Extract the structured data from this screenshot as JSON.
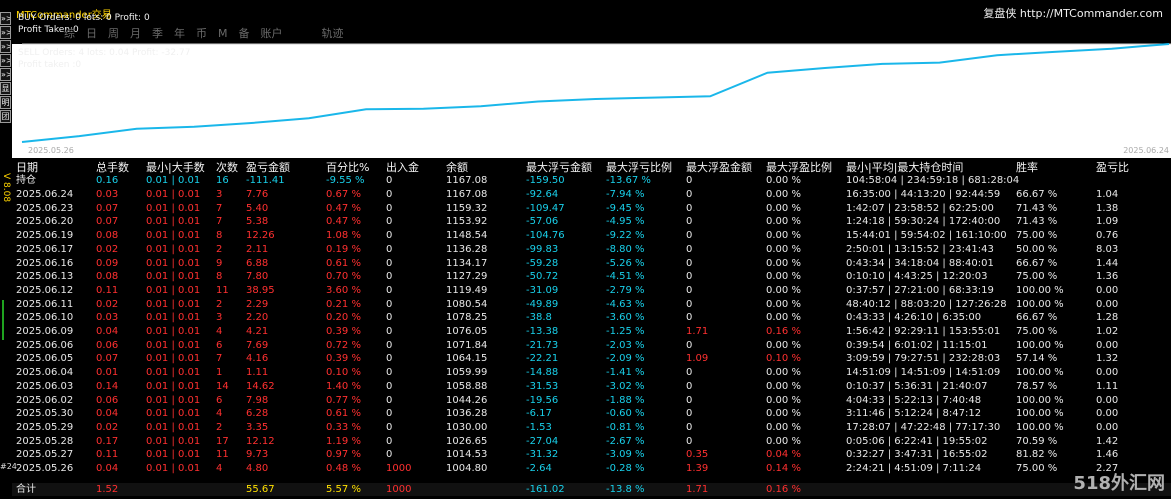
{
  "left_strip": {
    "buttons": [
      "»>",
      "»>",
      "»>",
      "»>",
      "»>",
      "显",
      "明",
      "团"
    ],
    "vertical_label": "V 8.08",
    "bottom_label": "#24"
  },
  "chart": {
    "app_title": "MTCommander交易",
    "buy_line": "BUY  Orders: 0 lots: 0 Profit: 0",
    "buy_profit_line": "Profit Taken:0",
    "sell_line": "SELL Orders: 4 lots: 0.04 Profit: -32.77",
    "sell_profit_line": "Profit taken :0",
    "tabs": [
      "综",
      "日",
      "周",
      "月",
      "季",
      "年",
      "币",
      "M",
      "备",
      "账户",
      "",
      "轨迹"
    ],
    "brand": "复盘侠 http://MTCommander.com",
    "date_start": "2025.05.26",
    "date_end": "2025.06.24",
    "line_color": "#1ab7ea",
    "equity": [
      1004.8,
      1014.53,
      1026.65,
      1030.0,
      1036.28,
      1044.26,
      1058.88,
      1059.99,
      1064.15,
      1071.84,
      1076.05,
      1078.25,
      1080.54,
      1119.49,
      1127.29,
      1134.17,
      1136.28,
      1148.54,
      1153.92,
      1159.32,
      1167.08
    ]
  },
  "table": {
    "headers": [
      "日期",
      "总手数",
      "最小|大手数",
      "次数",
      "盈亏金额",
      "百分比%",
      "出入金",
      "余额",
      "最大浮亏金额",
      "最大浮亏比例",
      "最大浮盈金额",
      "最大浮盈比例",
      "最小|平均|最大持仓时间",
      "胜率",
      "盈亏比"
    ],
    "holding": {
      "label": "持仓",
      "lots": "0.16",
      "minmax": "0.01 | 0.01",
      "count": "16",
      "pnl": "-111.41",
      "pct": "-9.55 %",
      "deposit": "0",
      "balance": "1167.08",
      "mfl": "-159.50",
      "mflp": "-13.67 %",
      "mfp": "0",
      "mfpp": "0.00 %",
      "time": "104:58:04 | 234:59:18 | 681:28:04",
      "win": "",
      "ratio": ""
    },
    "rows": [
      {
        "date": "2025.06.24",
        "lots": "0.03",
        "minmax": "0.01 | 0.01",
        "count": "3",
        "pnl": "7.76",
        "pct": "0.67 %",
        "deposit": "0",
        "balance": "1167.08",
        "mfl": "-92.64",
        "mflp": "-7.94 %",
        "mfp": "0",
        "mfpp": "0.00 %",
        "time": "16:35:00 | 44:13:20 | 92:44:59",
        "win": "66.67 %",
        "ratio": "1.04"
      },
      {
        "date": "2025.06.23",
        "lots": "0.07",
        "minmax": "0.01 | 0.01",
        "count": "7",
        "pnl": "5.40",
        "pct": "0.47 %",
        "deposit": "0",
        "balance": "1159.32",
        "mfl": "-109.47",
        "mflp": "-9.45 %",
        "mfp": "0",
        "mfpp": "0.00 %",
        "time": "1:42:07 | 23:58:52 | 62:25:00",
        "win": "71.43 %",
        "ratio": "1.38"
      },
      {
        "date": "2025.06.20",
        "lots": "0.07",
        "minmax": "0.01 | 0.01",
        "count": "7",
        "pnl": "5.38",
        "pct": "0.47 %",
        "deposit": "0",
        "balance": "1153.92",
        "mfl": "-57.06",
        "mflp": "-4.95 %",
        "mfp": "0",
        "mfpp": "0.00 %",
        "time": "1:24:18 | 59:30:24 | 172:40:00",
        "win": "71.43 %",
        "ratio": "1.09"
      },
      {
        "date": "2025.06.19",
        "lots": "0.08",
        "minmax": "0.01 | 0.01",
        "count": "8",
        "pnl": "12.26",
        "pct": "1.08 %",
        "deposit": "0",
        "balance": "1148.54",
        "mfl": "-104.76",
        "mflp": "-9.22 %",
        "mfp": "0",
        "mfpp": "0.00 %",
        "time": "15:44:01 | 59:54:02 | 161:10:00",
        "win": "75.00 %",
        "ratio": "0.76"
      },
      {
        "date": "2025.06.17",
        "lots": "0.02",
        "minmax": "0.01 | 0.01",
        "count": "2",
        "pnl": "2.11",
        "pct": "0.19 %",
        "deposit": "0",
        "balance": "1136.28",
        "mfl": "-99.83",
        "mflp": "-8.80 %",
        "mfp": "0",
        "mfpp": "0.00 %",
        "time": "2:50:01 | 13:15:52 | 23:41:43",
        "win": "50.00 %",
        "ratio": "8.03"
      },
      {
        "date": "2025.06.16",
        "lots": "0.09",
        "minmax": "0.01 | 0.01",
        "count": "9",
        "pnl": "6.88",
        "pct": "0.61 %",
        "deposit": "0",
        "balance": "1134.17",
        "mfl": "-59.28",
        "mflp": "-5.26 %",
        "mfp": "0",
        "mfpp": "0.00 %",
        "time": "0:43:34 | 34:18:04 | 88:40:01",
        "win": "66.67 %",
        "ratio": "1.44"
      },
      {
        "date": "2025.06.13",
        "lots": "0.08",
        "minmax": "0.01 | 0.01",
        "count": "8",
        "pnl": "7.80",
        "pct": "0.70 %",
        "deposit": "0",
        "balance": "1127.29",
        "mfl": "-50.72",
        "mflp": "-4.51 %",
        "mfp": "0",
        "mfpp": "0.00 %",
        "time": "0:10:10 | 4:43:25 | 12:20:03",
        "win": "75.00 %",
        "ratio": "1.36"
      },
      {
        "date": "2025.06.12",
        "lots": "0.11",
        "minmax": "0.01 | 0.01",
        "count": "11",
        "pnl": "38.95",
        "pct": "3.60 %",
        "deposit": "0",
        "balance": "1119.49",
        "mfl": "-31.09",
        "mflp": "-2.79 %",
        "mfp": "0",
        "mfpp": "0.00 %",
        "time": "0:37:57 | 27:21:00 | 68:33:19",
        "win": "100.00 %",
        "ratio": "0.00"
      },
      {
        "date": "2025.06.11",
        "lots": "0.02",
        "minmax": "0.01 | 0.01",
        "count": "2",
        "pnl": "2.29",
        "pct": "0.21 %",
        "deposit": "0",
        "balance": "1080.54",
        "mfl": "-49.89",
        "mflp": "-4.63 %",
        "mfp": "0",
        "mfpp": "0.00 %",
        "time": "48:40:12 | 88:03:20 | 127:26:28",
        "win": "100.00 %",
        "ratio": "0.00"
      },
      {
        "date": "2025.06.10",
        "lots": "0.03",
        "minmax": "0.01 | 0.01",
        "count": "3",
        "pnl": "2.20",
        "pct": "0.20 %",
        "deposit": "0",
        "balance": "1078.25",
        "mfl": "-38.8",
        "mflp": "-3.60 %",
        "mfp": "0",
        "mfpp": "0.00 %",
        "time": "0:43:33 | 4:26:10 | 6:35:00",
        "win": "66.67 %",
        "ratio": "1.28"
      },
      {
        "date": "2025.06.09",
        "lots": "0.04",
        "minmax": "0.01 | 0.01",
        "count": "4",
        "pnl": "4.21",
        "pct": "0.39 %",
        "deposit": "0",
        "balance": "1076.05",
        "mfl": "-13.38",
        "mflp": "-1.25 %",
        "mfp": "1.71",
        "mfpp": "0.16 %",
        "time": "1:56:42 | 92:29:11 | 153:55:01",
        "win": "75.00 %",
        "ratio": "1.02"
      },
      {
        "date": "2025.06.06",
        "lots": "0.06",
        "minmax": "0.01 | 0.01",
        "count": "6",
        "pnl": "7.69",
        "pct": "0.72 %",
        "deposit": "0",
        "balance": "1071.84",
        "mfl": "-21.73",
        "mflp": "-2.03 %",
        "mfp": "0",
        "mfpp": "0.00 %",
        "time": "0:39:54 | 6:01:02 | 11:15:01",
        "win": "100.00 %",
        "ratio": "0.00"
      },
      {
        "date": "2025.06.05",
        "lots": "0.07",
        "minmax": "0.01 | 0.01",
        "count": "7",
        "pnl": "4.16",
        "pct": "0.39 %",
        "deposit": "0",
        "balance": "1064.15",
        "mfl": "-22.21",
        "mflp": "-2.09 %",
        "mfp": "1.09",
        "mfpp": "0.10 %",
        "time": "3:09:59 | 79:27:51 | 232:28:03",
        "win": "57.14 %",
        "ratio": "1.32"
      },
      {
        "date": "2025.06.04",
        "lots": "0.01",
        "minmax": "0.01 | 0.01",
        "count": "1",
        "pnl": "1.11",
        "pct": "0.10 %",
        "deposit": "0",
        "balance": "1059.99",
        "mfl": "-14.88",
        "mflp": "-1.41 %",
        "mfp": "0",
        "mfpp": "0.00 %",
        "time": "14:51:09 | 14:51:09 | 14:51:09",
        "win": "100.00 %",
        "ratio": "0.00"
      },
      {
        "date": "2025.06.03",
        "lots": "0.14",
        "minmax": "0.01 | 0.01",
        "count": "14",
        "pnl": "14.62",
        "pct": "1.40 %",
        "deposit": "0",
        "balance": "1058.88",
        "mfl": "-31.53",
        "mflp": "-3.02 %",
        "mfp": "0",
        "mfpp": "0.00 %",
        "time": "0:10:37 | 5:36:31 | 21:40:07",
        "win": "78.57 %",
        "ratio": "1.11"
      },
      {
        "date": "2025.06.02",
        "lots": "0.06",
        "minmax": "0.01 | 0.01",
        "count": "6",
        "pnl": "7.98",
        "pct": "0.77 %",
        "deposit": "0",
        "balance": "1044.26",
        "mfl": "-19.56",
        "mflp": "-1.88 %",
        "mfp": "0",
        "mfpp": "0.00 %",
        "time": "4:04:33 | 5:22:13 | 7:40:48",
        "win": "100.00 %",
        "ratio": "0.00"
      },
      {
        "date": "2025.05.30",
        "lots": "0.04",
        "minmax": "0.01 | 0.01",
        "count": "4",
        "pnl": "6.28",
        "pct": "0.61 %",
        "deposit": "0",
        "balance": "1036.28",
        "mfl": "-6.17",
        "mflp": "-0.60 %",
        "mfp": "0",
        "mfpp": "0.00 %",
        "time": "3:11:46 | 5:12:24 | 8:47:12",
        "win": "100.00 %",
        "ratio": "0.00"
      },
      {
        "date": "2025.05.29",
        "lots": "0.02",
        "minmax": "0.01 | 0.01",
        "count": "2",
        "pnl": "3.35",
        "pct": "0.33 %",
        "deposit": "0",
        "balance": "1030.00",
        "mfl": "-1.53",
        "mflp": "-0.81 %",
        "mfp": "0",
        "mfpp": "0.00 %",
        "time": "17:28:07 | 47:22:48 | 77:17:30",
        "win": "100.00 %",
        "ratio": "0.00"
      },
      {
        "date": "2025.05.28",
        "lots": "0.17",
        "minmax": "0.01 | 0.01",
        "count": "17",
        "pnl": "12.12",
        "pct": "1.19 %",
        "deposit": "0",
        "balance": "1026.65",
        "mfl": "-27.04",
        "mflp": "-2.67 %",
        "mfp": "0",
        "mfpp": "0.00 %",
        "time": "0:05:06 | 6:22:41 | 19:55:02",
        "win": "70.59 %",
        "ratio": "1.42"
      },
      {
        "date": "2025.05.27",
        "lots": "0.11",
        "minmax": "0.01 | 0.01",
        "count": "11",
        "pnl": "9.73",
        "pct": "0.97 %",
        "deposit": "0",
        "balance": "1014.53",
        "mfl": "-31.32",
        "mflp": "-3.09 %",
        "mfp": "0.35",
        "mfpp": "0.04 %",
        "time": "0:32:27 | 3:47:31 | 16:55:02",
        "win": "81.82 %",
        "ratio": "1.46"
      },
      {
        "date": "2025.05.26",
        "lots": "0.04",
        "minmax": "0.01 | 0.01",
        "count": "4",
        "pnl": "4.80",
        "pct": "0.48 %",
        "deposit": "1000",
        "balance": "1004.80",
        "mfl": "-2.64",
        "mflp": "-0.28 %",
        "mfp": "1.39",
        "mfpp": "0.14 %",
        "time": "2:24:21 | 4:51:09 | 7:11:24",
        "win": "75.00 %",
        "ratio": "2.27"
      }
    ],
    "total": {
      "label": "合计",
      "lots": "1.52",
      "minmax": "",
      "count": "",
      "pnl": "55.67",
      "pct": "5.57 %",
      "deposit": "1000",
      "balance": "",
      "mfl": "-161.02",
      "mflp": "-13.8 %",
      "mfp": "1.71",
      "mfpp": "0.16 %",
      "time": "",
      "win": "",
      "ratio": ""
    }
  },
  "watermark": "518外汇网"
}
